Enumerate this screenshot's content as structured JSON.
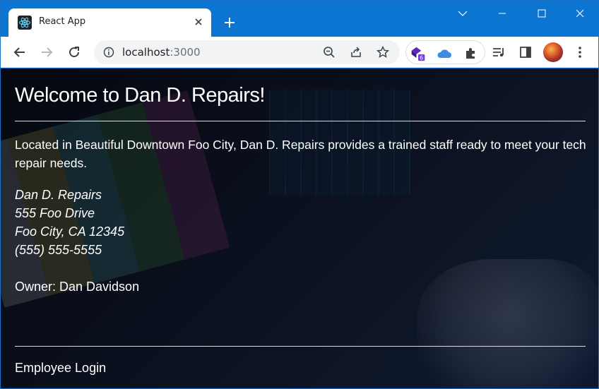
{
  "browser": {
    "tab_title": "React App",
    "url_host": "localhost",
    "url_port": ":3000",
    "extension_badge": "6",
    "icons": {
      "favicon": "react-icon",
      "close_tab": "close-icon",
      "new_tab": "plus-icon",
      "back": "arrow-left-icon",
      "forward": "arrow-right-icon",
      "reload": "reload-icon",
      "site_info": "info-icon",
      "zoom": "zoom-out-icon",
      "share": "share-icon",
      "bookmark": "star-icon",
      "extensions": "puzzle-icon",
      "media": "media-queue-icon",
      "side_panel": "side-panel-icon",
      "menu": "kebab-menu-icon"
    },
    "colors": {
      "titlebar": "#0b75d1",
      "toolbar": "#ffffff"
    }
  },
  "page": {
    "heading": "Welcome to Dan D. Repairs!",
    "intro": "Located in Beautiful Downtown Foo City, Dan D. Repairs provides a trained staff ready to meet your tech repair needs.",
    "address": {
      "name": "Dan D. Repairs",
      "street": "555 Foo Drive",
      "city": "Foo City, CA 12345",
      "phone": "(555) 555-5555"
    },
    "owner": "Owner: Dan Davidson",
    "login_link": "Employee Login"
  }
}
